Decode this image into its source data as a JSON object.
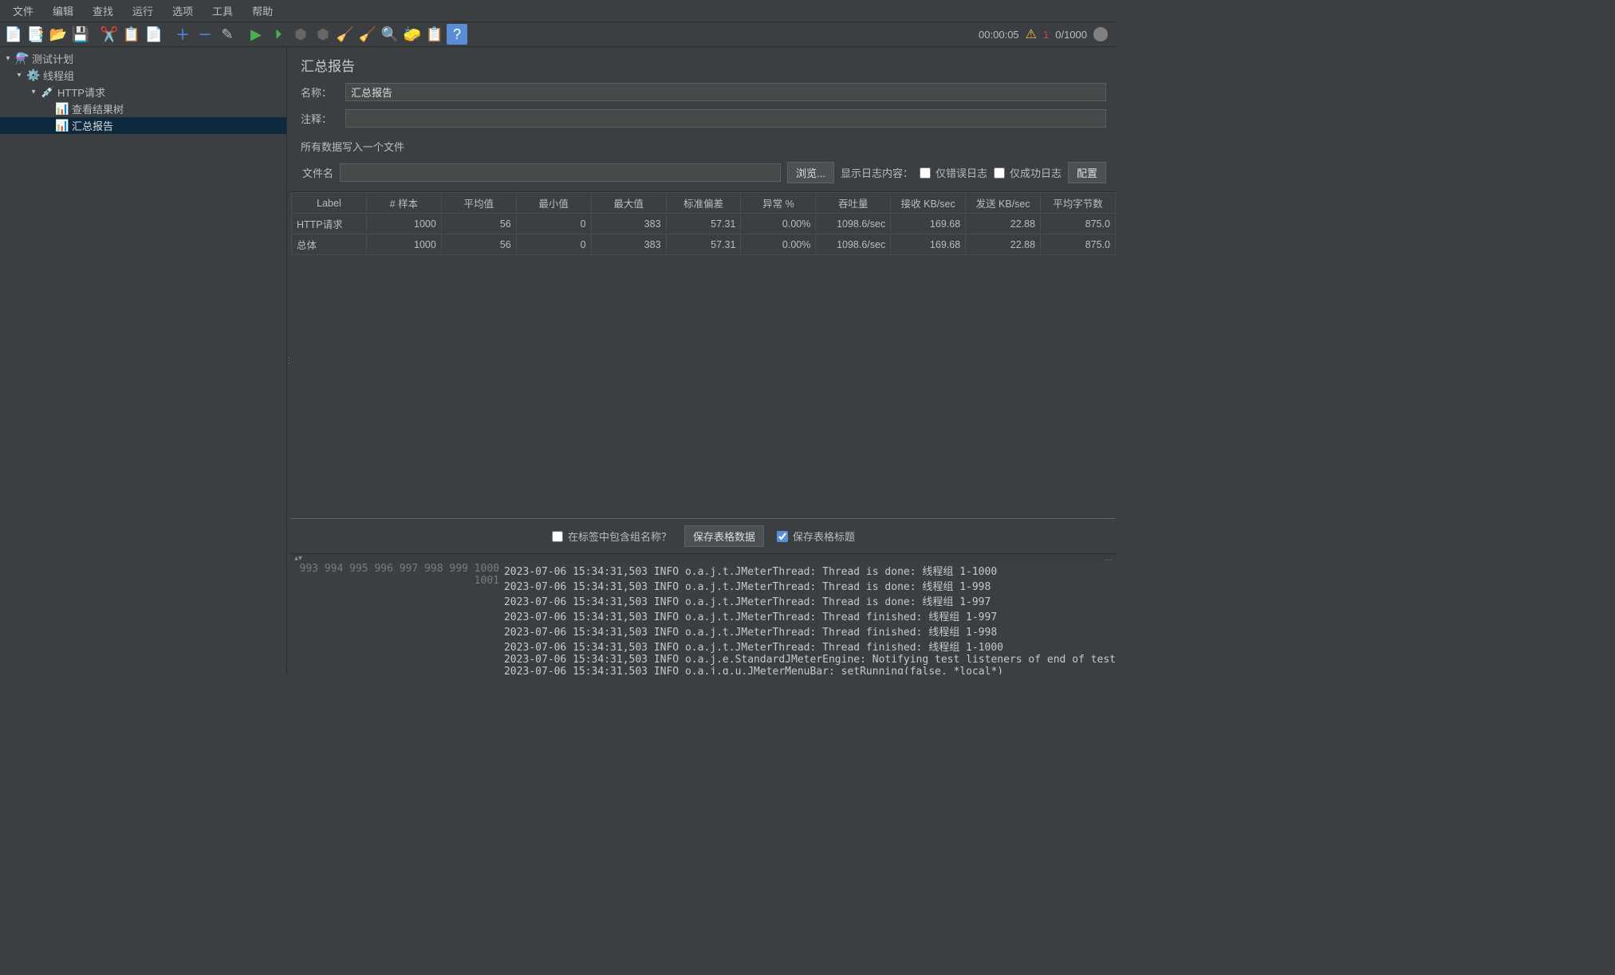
{
  "menu": {
    "file": "文件",
    "edit": "编辑",
    "search": "查找",
    "run": "运行",
    "options": "选项",
    "tools": "工具",
    "help": "帮助"
  },
  "status": {
    "timer": "00:00:05",
    "warnings": "1",
    "threads": "0/1000"
  },
  "tree": {
    "testPlan": "测试计划",
    "threadGroup": "线程组",
    "httpRequest": "HTTP请求",
    "viewResults": "查看结果树",
    "summaryReport": "汇总报告"
  },
  "panel": {
    "title": "汇总报告",
    "nameLabel": "名称：",
    "nameValue": "汇总报告",
    "commentLabel": "注释：",
    "commentValue": "",
    "groupLabel": "所有数据写入一个文件",
    "fileLabel": "文件名",
    "fileValue": "",
    "browseBtn": "浏览...",
    "logInfoLabel": "显示日志内容：",
    "errorsOnly": "仅错误日志",
    "successOnly": "仅成功日志",
    "configBtn": "配置"
  },
  "table": {
    "headers": [
      "Label",
      "# 样本",
      "平均值",
      "最小值",
      "最大值",
      "标准偏差",
      "异常 %",
      "吞吐量",
      "接收 KB/sec",
      "发送 KB/sec",
      "平均字节数"
    ],
    "rows": [
      {
        "label": "HTTP请求",
        "samples": "1000",
        "avg": "56",
        "min": "0",
        "max": "383",
        "stddev": "57.31",
        "error": "0.00%",
        "throughput": "1098.6/sec",
        "recv": "169.68",
        "sent": "22.88",
        "bytes": "875.0"
      },
      {
        "label": "总体",
        "samples": "1000",
        "avg": "56",
        "min": "0",
        "max": "383",
        "stddev": "57.31",
        "error": "0.00%",
        "throughput": "1098.6/sec",
        "recv": "169.68",
        "sent": "22.88",
        "bytes": "875.0"
      }
    ],
    "includeGroupLabel": "在标签中包含组名称？",
    "saveDataBtn": "保存表格数据",
    "saveHeaderLabel": "保存表格标题"
  },
  "log": {
    "lines": [
      {
        "n": "993",
        "t": "2023-07-06 15:34:31,503 INFO o.a.j.t.JMeterThread: Thread is done: 线程组 1-1000"
      },
      {
        "n": "994",
        "t": "2023-07-06 15:34:31,503 INFO o.a.j.t.JMeterThread: Thread is done: 线程组 1-998"
      },
      {
        "n": "995",
        "t": "2023-07-06 15:34:31,503 INFO o.a.j.t.JMeterThread: Thread is done: 线程组 1-997"
      },
      {
        "n": "996",
        "t": "2023-07-06 15:34:31,503 INFO o.a.j.t.JMeterThread: Thread finished: 线程组 1-997"
      },
      {
        "n": "997",
        "t": "2023-07-06 15:34:31,503 INFO o.a.j.t.JMeterThread: Thread finished: 线程组 1-998"
      },
      {
        "n": "998",
        "t": "2023-07-06 15:34:31,503 INFO o.a.j.t.JMeterThread: Thread finished: 线程组 1-1000"
      },
      {
        "n": "999",
        "t": "2023-07-06 15:34:31,503 INFO o.a.j.e.StandardJMeterEngine: Notifying test listeners of end of test"
      },
      {
        "n": "1000",
        "t": "2023-07-06 15:34:31,503 INFO o.a.j.g.u.JMeterMenuBar: setRunning(false, *local*)"
      },
      {
        "n": "1001",
        "t": ""
      }
    ]
  }
}
